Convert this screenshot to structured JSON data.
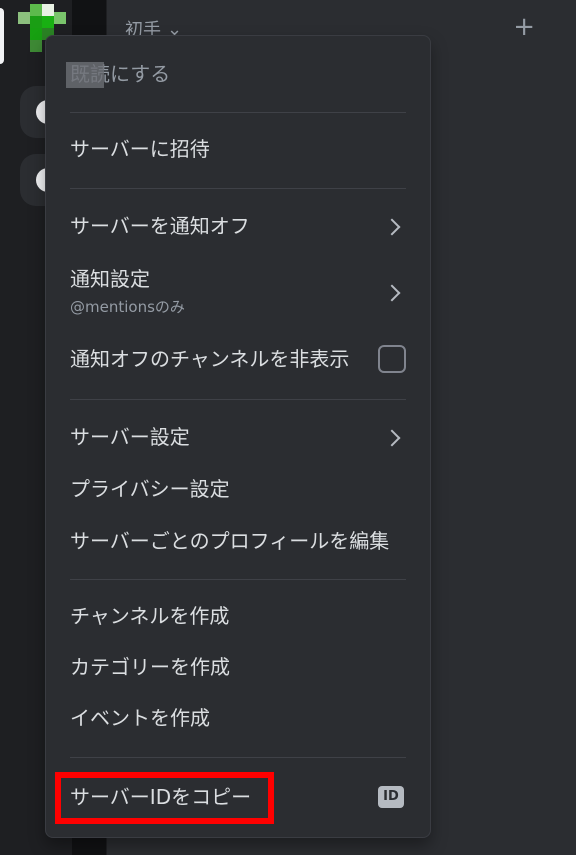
{
  "header": {
    "channel_group": "初手",
    "chevron": "chevron-down-icon",
    "add": "+"
  },
  "menu": {
    "top_item": "既読にする",
    "invite": "サーバーに招待",
    "mute_server": "サーバーを通知オフ",
    "notify_settings": "通知設定",
    "notify_settings_sub": "@mentionsのみ",
    "hide_muted": "通知オフのチャンネルを非表示",
    "server_settings": "サーバー設定",
    "privacy_settings": "プライバシー設定",
    "edit_profile": "サーバーごとのプロフィールを編集",
    "create_channel": "チャンネルを作成",
    "create_category": "カテゴリーを作成",
    "create_event": "イベントを作成",
    "copy_id": "サーバーIDをコピー",
    "id_badge": "ID"
  },
  "colors": {
    "highlight": "#ff0000",
    "menu_bg": "#2b2d31",
    "text": "#dbdee1",
    "muted": "#949ba4"
  }
}
